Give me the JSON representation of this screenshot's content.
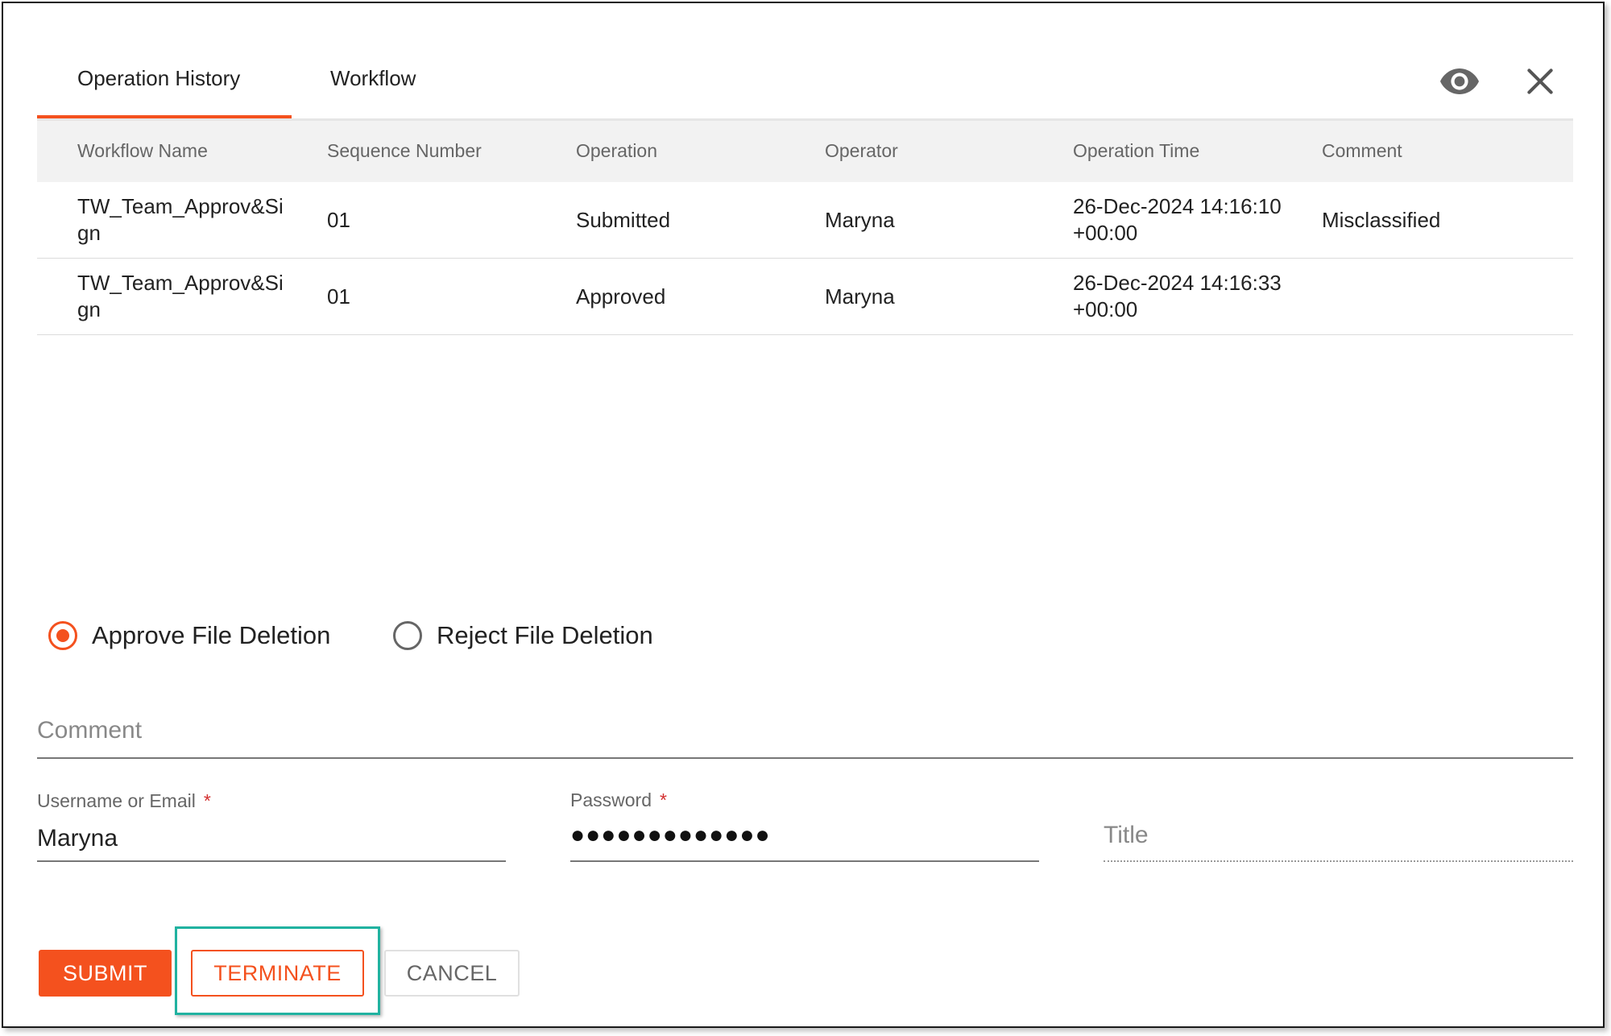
{
  "tabs": [
    {
      "label": "Operation History",
      "active": true
    },
    {
      "label": "Workflow",
      "active": false
    }
  ],
  "header_icons": {
    "view": "eye-icon",
    "close": "close-icon"
  },
  "table": {
    "columns": [
      "Workflow Name",
      "Sequence Number",
      "Operation",
      "Operator",
      "Operation Time",
      "Comment"
    ],
    "rows": [
      {
        "workflow_name": "TW_Team_Approv&Sign",
        "sequence_number": "01",
        "operation": "Submitted",
        "operator": "Maryna",
        "operation_time": "26-Dec-2024 14:16:10 +00:00",
        "comment": "Misclassified"
      },
      {
        "workflow_name": "TW_Team_Approv&Sign",
        "sequence_number": "01",
        "operation": "Approved",
        "operator": "Maryna",
        "operation_time": "26-Dec-2024 14:16:33 +00:00",
        "comment": ""
      }
    ]
  },
  "decision": {
    "options": [
      {
        "label": "Approve File Deletion",
        "selected": true
      },
      {
        "label": "Reject File Deletion",
        "selected": false
      }
    ]
  },
  "form": {
    "comment_placeholder": "Comment",
    "username_label": "Username or Email",
    "username_value": "Maryna",
    "password_label": "Password",
    "password_masked": "●●●●●●●●●●●●●",
    "title_placeholder": "Title",
    "required_marker": "*"
  },
  "buttons": {
    "submit": "SUBMIT",
    "terminate": "TERMINATE",
    "cancel": "CANCEL"
  },
  "colors": {
    "accent": "#f4511e",
    "highlight": "#20b2a0",
    "header_bg": "#f2f2f2"
  }
}
